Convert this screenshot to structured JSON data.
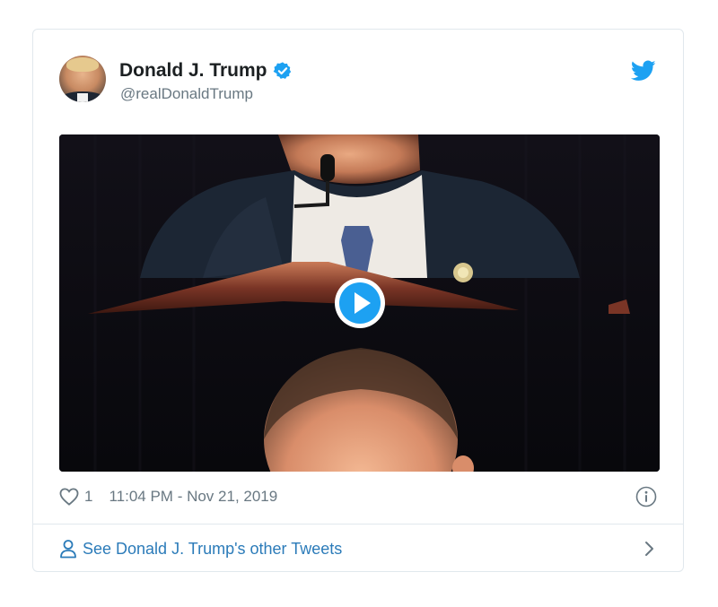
{
  "author": {
    "name": "Donald J. Trump",
    "handle": "@realDonaldTrump",
    "verified": true,
    "avatar_icon": "profile-photo"
  },
  "brand": {
    "icon": "twitter-bird-icon",
    "color": "#1da1f2"
  },
  "media": {
    "type": "video",
    "play_icon": "play-icon"
  },
  "footer": {
    "likes": "1",
    "timestamp": "11:04 PM - Nov 21, 2019",
    "info_icon": "info-icon"
  },
  "cta": {
    "label": "See Donald J. Trump's other Tweets",
    "icon": "person-icon",
    "chevron_icon": "chevron-right-icon"
  },
  "colors": {
    "link": "#2b7bb9",
    "muted": "#697882",
    "border": "#e1e8ed",
    "accent": "#1da1f2"
  }
}
